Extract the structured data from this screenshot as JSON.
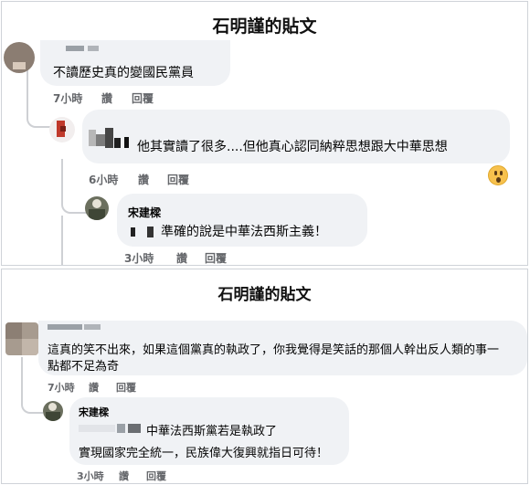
{
  "top": {
    "title": "石明謹的貼文",
    "comment1": {
      "text": "不讀歷史真的變國民黨員",
      "time": "7小時",
      "like": "讚",
      "reply": "回覆"
    },
    "comment2": {
      "text": "他其實讀了很多....但他真心認同納粹思想跟大中華思想",
      "time": "6小時",
      "like": "讚",
      "reply": "回覆"
    },
    "comment3": {
      "author": "宋建樑",
      "text": "準確的說是中華法西斯主義！",
      "time": "3小時",
      "like": "讚",
      "reply": "回覆"
    }
  },
  "bottom": {
    "title": "石明謹的貼文",
    "comment1": {
      "line1": "這真的笑不出來，如果這個黨真的執政了，你我覺得是笑話的那個人幹出反人類的事一",
      "line2": "點都不足為奇",
      "time": "7小時",
      "like": "讚",
      "reply": "回覆"
    },
    "comment2": {
      "author": "宋建樑",
      "line1": "中華法西斯黨若是執政了",
      "line2": "實現國家完全統一，民族偉大復興就指日可待！",
      "time": "3小時",
      "like": "讚",
      "reply": "回覆"
    }
  },
  "colors": {
    "bubble": "#f0f2f5",
    "meta": "#65676b",
    "thread": "#ced0d4"
  },
  "icons": {
    "reaction": "wow-emoji-icon"
  }
}
